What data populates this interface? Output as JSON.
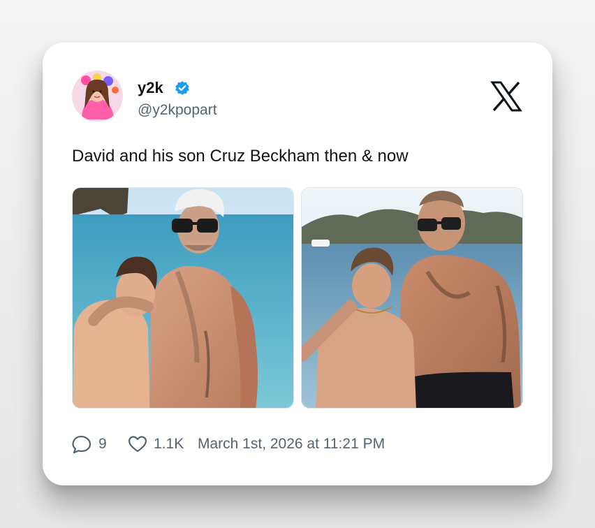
{
  "tweet": {
    "author": {
      "display_name": "y2k",
      "handle": "@y2kpopart",
      "verified": true,
      "avatar_icon": "avatar-image"
    },
    "text": "David and his son Cruz Beckham then & now",
    "platform_icon": "x-logo-icon",
    "media": [
      {
        "description_icon": "photo-then"
      },
      {
        "description_icon": "photo-now"
      }
    ],
    "stats": {
      "replies": "9",
      "likes": "1.1K"
    },
    "timestamp": "March 1st, 2026 at 11:21 PM"
  },
  "colors": {
    "verified_blue": "#1d9bf0",
    "text_primary": "#0f1419",
    "text_secondary": "#536471"
  }
}
